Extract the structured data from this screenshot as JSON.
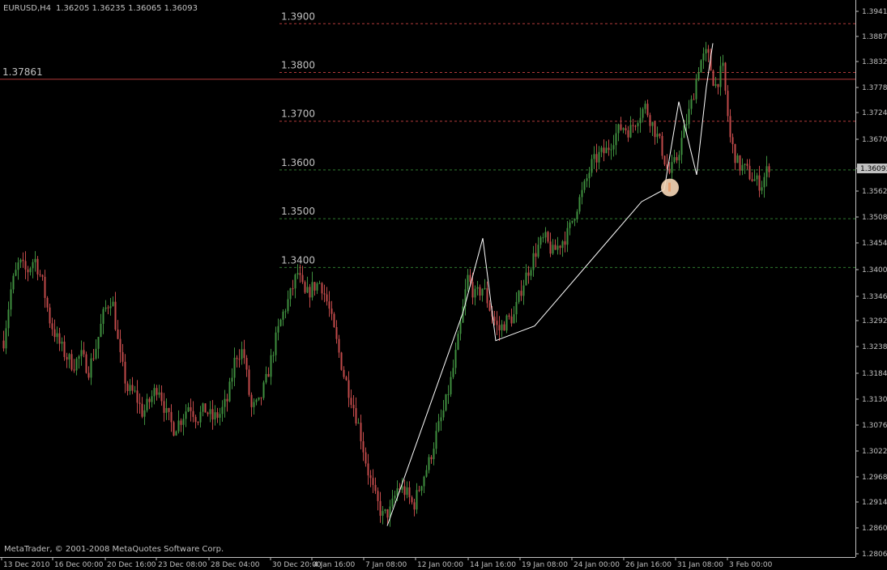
{
  "header": {
    "symbol_tf": "EURUSD,H4",
    "quotes": "1.36205 1.36235 1.36065 1.36093"
  },
  "footer": {
    "copyright": "MetaTrader, © 2001-2008 MetaQuotes Software Corp."
  },
  "colors": {
    "background": "#000000",
    "grid_border": "#c0c0c0",
    "bull_candle": "#3f8f3f",
    "bear_candle": "#c14a4a",
    "hline_red": "#b23a3a",
    "hline_green": "#2f7a2f",
    "zigzag": "#ffffff",
    "marker": "#f8d8b8"
  },
  "chart_data": {
    "type": "candlestick",
    "y_axis": {
      "ylim": [
        1.2806,
        1.3942
      ],
      "tick_labels": [
        "1.39415",
        "1.38875",
        "1.38320",
        "1.37780",
        "1.37240",
        "1.36700",
        "1.36093",
        "1.35620",
        "1.35080",
        "1.34540",
        "1.34000",
        "1.33460",
        "1.32920",
        "1.32380",
        "1.31840",
        "1.31300",
        "1.30760",
        "1.30220",
        "1.29680",
        "1.29140",
        "1.28600",
        "1.28060"
      ],
      "current_price": "1.36093"
    },
    "x_axis": {
      "tick_labels": [
        "13 Dec 2010",
        "16 Dec 00:00",
        "20 Dec 16:00",
        "23 Dec 08:00",
        "28 Dec 04:00",
        "30 Dec 20:00",
        "4 Jan 16:00",
        "7 Jan 08:00",
        "12 Jan 00:00",
        "14 Jan 16:00",
        "19 Jan 08:00",
        "24 Jan 00:00",
        "26 Jan 16:00",
        "31 Jan 08:00",
        "3 Feb 00:00"
      ]
    },
    "horizontal_levels": [
      {
        "label": "1.3900",
        "value": 1.39,
        "color": "red",
        "style": "dashed"
      },
      {
        "label": "1.3800",
        "value": 1.38,
        "color": "red",
        "style": "dashed"
      },
      {
        "label": "1.3700",
        "value": 1.37,
        "color": "red",
        "style": "dashed"
      },
      {
        "label": "1.3600",
        "value": 1.36,
        "color": "green",
        "style": "dashed"
      },
      {
        "label": "1.3500",
        "value": 1.35,
        "color": "green",
        "style": "dashed"
      },
      {
        "label": "1.3400",
        "value": 1.34,
        "color": "green",
        "style": "dashed"
      }
    ],
    "solid_level": {
      "label": "1.37861",
      "value": 1.37861
    },
    "price_path": [
      [
        0,
        1.325
      ],
      [
        1,
        1.336
      ],
      [
        2,
        1.341
      ],
      [
        3,
        1.339
      ],
      [
        4,
        1.342
      ],
      [
        5,
        1.337
      ],
      [
        6,
        1.329
      ],
      [
        7,
        1.325
      ],
      [
        8,
        1.322
      ],
      [
        9,
        1.32
      ],
      [
        10,
        1.322
      ],
      [
        11,
        1.319
      ],
      [
        12,
        1.324
      ],
      [
        13,
        1.331
      ],
      [
        14,
        1.334
      ],
      [
        15,
        1.322
      ],
      [
        16,
        1.315
      ],
      [
        17,
        1.314
      ],
      [
        18,
        1.31
      ],
      [
        19,
        1.313
      ],
      [
        20,
        1.316
      ],
      [
        21,
        1.31
      ],
      [
        22,
        1.307
      ],
      [
        23,
        1.309
      ],
      [
        24,
        1.312
      ],
      [
        25,
        1.309
      ],
      [
        26,
        1.311
      ],
      [
        27,
        1.309
      ],
      [
        28,
        1.31
      ],
      [
        29,
        1.313
      ],
      [
        30,
        1.322
      ],
      [
        31,
        1.323
      ],
      [
        32,
        1.311
      ],
      [
        33,
        1.312
      ],
      [
        34,
        1.317
      ],
      [
        35,
        1.324
      ],
      [
        36,
        1.33
      ],
      [
        37,
        1.334
      ],
      [
        38,
        1.339
      ],
      [
        39,
        1.334
      ],
      [
        40,
        1.336
      ],
      [
        41,
        1.337
      ],
      [
        42,
        1.332
      ],
      [
        43,
        1.325
      ],
      [
        44,
        1.318
      ],
      [
        45,
        1.313
      ],
      [
        46,
        1.307
      ],
      [
        47,
        1.299
      ],
      [
        48,
        1.293
      ],
      [
        49,
        1.289
      ],
      [
        50,
        1.29
      ],
      [
        51,
        1.295
      ],
      [
        52,
        1.294
      ],
      [
        53,
        1.291
      ],
      [
        54,
        1.296
      ],
      [
        55,
        1.3
      ],
      [
        56,
        1.306
      ],
      [
        57,
        1.311
      ],
      [
        58,
        1.318
      ],
      [
        59,
        1.327
      ],
      [
        60,
        1.338
      ],
      [
        61,
        1.334
      ],
      [
        62,
        1.336
      ],
      [
        63,
        1.331
      ],
      [
        64,
        1.327
      ],
      [
        65,
        1.329
      ],
      [
        66,
        1.33
      ],
      [
        67,
        1.336
      ],
      [
        68,
        1.34
      ],
      [
        69,
        1.344
      ],
      [
        70,
        1.346
      ],
      [
        71,
        1.343
      ],
      [
        72,
        1.345
      ],
      [
        73,
        1.347
      ],
      [
        74,
        1.352
      ],
      [
        75,
        1.356
      ],
      [
        76,
        1.361
      ],
      [
        77,
        1.363
      ],
      [
        78,
        1.364
      ],
      [
        79,
        1.367
      ],
      [
        80,
        1.369
      ],
      [
        81,
        1.368
      ],
      [
        82,
        1.371
      ],
      [
        83,
        1.373
      ],
      [
        84,
        1.369
      ],
      [
        85,
        1.365
      ],
      [
        86,
        1.359
      ],
      [
        87,
        1.362
      ],
      [
        88,
        1.368
      ],
      [
        89,
        1.374
      ],
      [
        90,
        1.382
      ],
      [
        91,
        1.384
      ],
      [
        92,
        1.377
      ],
      [
        93,
        1.381
      ],
      [
        94,
        1.366
      ],
      [
        95,
        1.361
      ],
      [
        96,
        1.36
      ],
      [
        97,
        1.358
      ],
      [
        98,
        1.357
      ],
      [
        99,
        1.361
      ]
    ],
    "zigzag_points": [
      [
        -0.2,
        1.287
      ],
      [
        0.4,
        1.331
      ],
      [
        0.555,
        1.346
      ],
      [
        0.66,
        1.325
      ],
      [
        0.75,
        1.328
      ],
      [
        0.865,
        1.3535
      ],
      [
        1.0,
        1.356
      ],
      [
        1.12,
        1.374
      ],
      [
        1.22,
        1.359
      ],
      [
        1.315,
        1.377
      ],
      [
        1.38,
        1.386
      ]
    ],
    "circle_marker": {
      "value": 1.3564
    }
  }
}
